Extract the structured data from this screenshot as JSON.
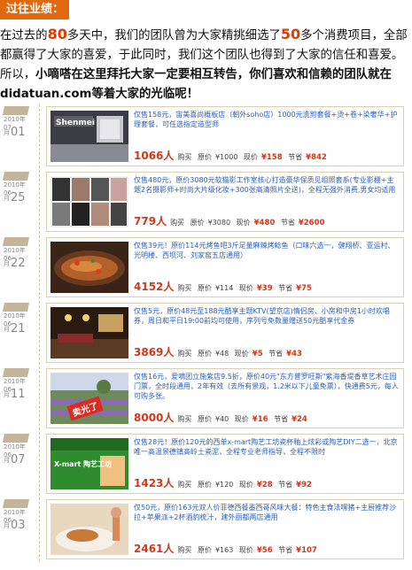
{
  "header": {
    "title": "过往业绩："
  },
  "intro": {
    "p1_a": "在过去的",
    "p1_days": "80",
    "p1_b": "多天中，我们的团队曾为大家精挑细选了",
    "p1_count": "50",
    "p1_c": "多个消费项目，全部都赢得了大家的喜爱，于此同时，我们这个团队也得到了大家的信任和喜爱。所以，",
    "p1_bold": "小嘀嗒在这里拜托大家一定要相互转告，你们喜欢和信赖的团队就在didatuan.com等着大家的光临呢！"
  },
  "deals": [
    {
      "ym": "2010年07",
      "day": "01",
      "day_prefix": "月",
      "desc": "仅售158元，宙美喜尚概板店（朝外soho店）1000元洗剪套餐+烫+卷+染奢华+护理套餐，可任选指定造型师",
      "count": "1066人",
      "buy_label": "购买",
      "orig_label": "原价",
      "orig": "¥1000",
      "cur_label": "现价",
      "cur": "¥158",
      "save_label": "节省",
      "save": "¥842",
      "thumb_text": "Shenmei",
      "thumb_color": "#6a6a70"
    },
    {
      "ym": "2010年06",
      "day": "25",
      "day_prefix": "月",
      "desc": "仅售480元，原价3080元软猫影工作室核心打造豪华保质见组照套系(专业影棚+主题2名摄影师+时尚大片级化妆+300张高清照片全送)，全程无强外消费,男女均适用",
      "count": "779人",
      "buy_label": "购买",
      "orig_label": "原价",
      "orig": "¥3080",
      "cur_label": "现价",
      "cur": "¥480",
      "save_label": "节省",
      "save": "¥2600",
      "thumb_text": "",
      "thumb_color": "#8b8b8b"
    },
    {
      "ym": "2010年06",
      "day": "22",
      "day_prefix": "月",
      "desc": "仅售39元！原价114元烤鱼吧3斤足量麻辣烤鲶鱼（口味六选一，健翔桥、亚运村、光明楼、西坝河、刘家窑五店通用）",
      "count": "4152人",
      "buy_label": "购买",
      "orig_label": "原价",
      "orig": "¥114",
      "cur_label": "现价",
      "cur": "¥39",
      "save_label": "节省",
      "save": "¥75",
      "thumb_text": "",
      "thumb_color": "#b45a28"
    },
    {
      "ym": "2010年06",
      "day": "21",
      "day_prefix": "月",
      "desc": "仅售5元，原价48元至188元酷享主题KTV(望京店)情侣房、小房和中房1小时欢唱券，周日和平日19:00前均可使用，序列号免数量赠送50元酷享代金券",
      "count": "3869人",
      "buy_label": "购买",
      "orig_label": "原价",
      "orig": "¥48",
      "cur_label": "现价",
      "cur": "¥5",
      "save_label": "节省",
      "save": "¥43",
      "thumb_text": "",
      "thumb_color": "#5a3a22"
    },
    {
      "ym": "2010年06",
      "day": "11",
      "day_prefix": "月",
      "desc": "仅售16元，爱嘀团立施紫店9.5折，原价40元\"东方普罗旺斯\"紫海香堤香草艺术庄园门票，全时段通用，2年有效（去所有景观，1.2米以下儿童免票），快通费5元，每人可购多张。",
      "count": "8000人",
      "buy_label": "购买",
      "orig_label": "原价",
      "orig": "¥40",
      "cur_label": "现价",
      "cur": "¥16",
      "save_label": "节省",
      "save": "¥24",
      "thumb_text": "卖光了",
      "thumb_color": "#6e8a5a"
    },
    {
      "ym": "2010年06",
      "day": "07",
      "day_prefix": "月",
      "desc": "仅售28元！原价120元的西单x-mart陶艺工坊瓷杯釉上炫彩或陶艺DIY二选一，北京唯一高温景德镇高岭土瓷泥，全程专业老师指导，全程不限时",
      "count": "1423人",
      "buy_label": "购买",
      "orig_label": "原价",
      "orig": "¥120",
      "cur_label": "现价",
      "cur": "¥28",
      "save_label": "节省",
      "save": "¥92",
      "thumb_text": "X-mart 陶艺工坊",
      "thumb_color": "#2e8b2e"
    },
    {
      "ym": "2010年06",
      "day": "03",
      "day_prefix": "月",
      "desc": "仅50元，原价163元双人价菲德西餐墨西哥风味大餐：特色主食法嘿猪+主厨推荐沙拉+苹果派+2杯酒豹梳汁，建外丽都两店通用",
      "count": "2461人",
      "buy_label": "购买",
      "orig_label": "原价",
      "orig": "¥163",
      "cur_label": "现价",
      "cur": "¥56",
      "save_label": "节省",
      "save": "¥107",
      "thumb_text": "",
      "thumb_color": "#c79a70"
    }
  ],
  "colors": {
    "accent": "#e0690f",
    "price": "#d0391c",
    "link": "#2d5fb5"
  }
}
